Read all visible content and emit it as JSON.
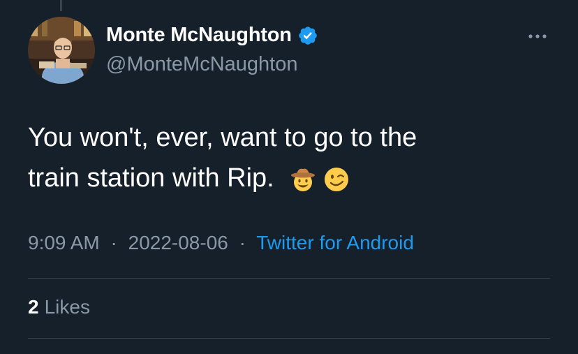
{
  "author": {
    "display_name": "Monte McNaughton",
    "handle": "@MonteMcNaughton",
    "verified": true
  },
  "tweet": {
    "text_line1": "You won't, ever, want to go to the",
    "text_line2": "train station with Rip.",
    "emojis": [
      "cowboy-hat-face",
      "winking-face"
    ]
  },
  "meta": {
    "time": "9:09 AM",
    "separator": "·",
    "date": "2022-08-06",
    "source": "Twitter for Android"
  },
  "engagement": {
    "likes_count": "2",
    "likes_label": "Likes"
  },
  "icons": {
    "verified": "verified-badge-icon",
    "more": "more-options-icon"
  },
  "colors": {
    "background": "#15202b",
    "primary_text": "#ffffff",
    "secondary_text": "#8b98a5",
    "link": "#1d9bf0",
    "verified": "#1d9bf0",
    "divider": "#38444d"
  }
}
